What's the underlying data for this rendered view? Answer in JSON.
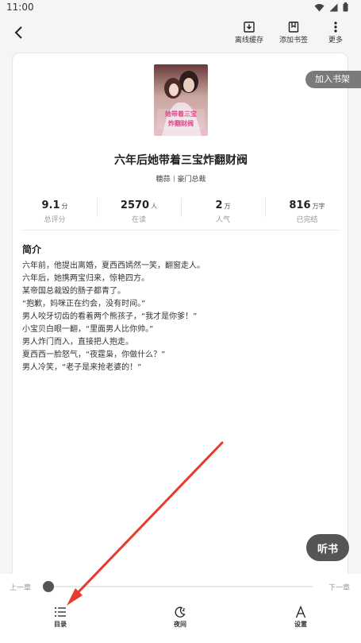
{
  "status_bar": {
    "time": "11:00"
  },
  "topbar": {
    "actions": [
      {
        "label": "离线缓存",
        "icon": "download-icon"
      },
      {
        "label": "添加书签",
        "icon": "bookmark-icon"
      },
      {
        "label": "更多",
        "icon": "more-vertical-icon"
      }
    ]
  },
  "shelf_button": "加入书架",
  "book": {
    "cover": {
      "line1": "她带着三宝",
      "line2": "炸翻财阀",
      "accent": "#d94b8c"
    },
    "title": "六年后她带着三宝炸翻财阀",
    "author": "糖蒜",
    "category": "豪门总裁",
    "stats": [
      {
        "value": "9.1",
        "unit": "分",
        "label": "总评分"
      },
      {
        "value": "2570",
        "unit": "人",
        "label": "在读"
      },
      {
        "value": "2",
        "unit": "万",
        "label": "人气"
      },
      {
        "value": "816",
        "unit": "万字",
        "label": "已完结"
      }
    ],
    "intro_title": "简介",
    "intro_lines": [
      "六年前，他提出离婚，夏西西嫣然一笑，翻窗走人。",
      "六年后，她携两宝归来，惊艳四方。",
      "某帝国总裁毁的肠子都青了。",
      "“抱歉，妈咪正在约会，没有时间。”",
      "男人咬牙切齿的看着两个熊孩子，“我才是你爹！”",
      "小宝贝白眼一翻，“里面男人比你帅。”",
      "男人炸门而入，直接把人抱走。",
      "夏西西一脸怒气，“夜霆枭，你做什么？”",
      "男人冷笑，“老子是来抢老婆的！”"
    ]
  },
  "listen_button": "听书",
  "chapter_nav": {
    "prev": "上一章",
    "next": "下一章",
    "progress": 0
  },
  "bottom_nav": [
    {
      "label": "目录",
      "icon": "list-icon"
    },
    {
      "label": "夜间",
      "icon": "moon-icon"
    },
    {
      "label": "设置",
      "icon": "font-settings-icon"
    }
  ],
  "annotation": {
    "color": "#e63b2e",
    "type": "red-arrow"
  }
}
